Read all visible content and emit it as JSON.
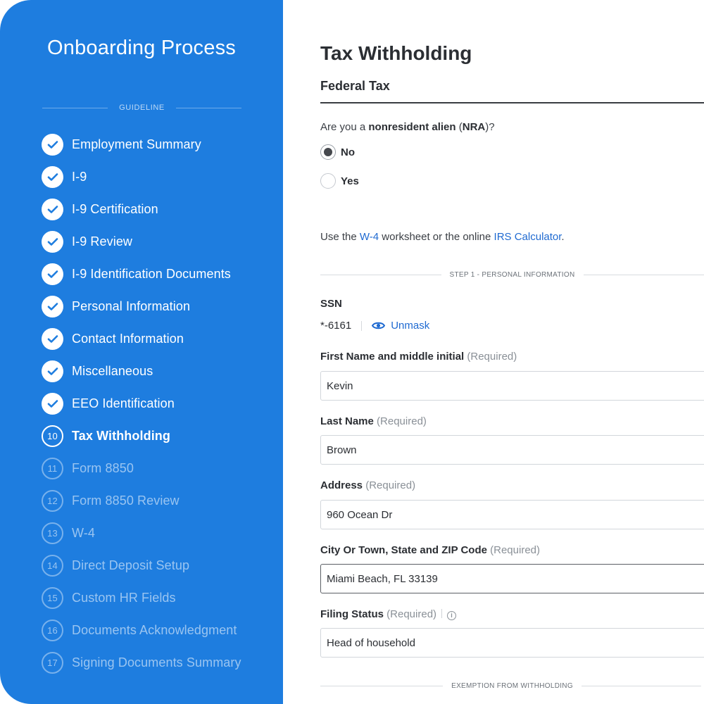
{
  "sidebar": {
    "title": "Onboarding Process",
    "guideline_label": "GUIDELINE",
    "steps": [
      {
        "number": "1",
        "label": "Employment Summary",
        "status": "done"
      },
      {
        "number": "2",
        "label": "I-9",
        "status": "done"
      },
      {
        "number": "3",
        "label": "I-9 Certification",
        "status": "done"
      },
      {
        "number": "4",
        "label": "I-9 Review",
        "status": "done"
      },
      {
        "number": "5",
        "label": "I-9 Identification Documents",
        "status": "done"
      },
      {
        "number": "6",
        "label": "Personal Information",
        "status": "done"
      },
      {
        "number": "7",
        "label": "Contact Information",
        "status": "done"
      },
      {
        "number": "8",
        "label": "Miscellaneous",
        "status": "done"
      },
      {
        "number": "9",
        "label": "EEO Identification",
        "status": "done"
      },
      {
        "number": "10",
        "label": "Tax Withholding",
        "status": "current"
      },
      {
        "number": "11",
        "label": "Form 8850",
        "status": "pending"
      },
      {
        "number": "12",
        "label": "Form 8850 Review",
        "status": "pending"
      },
      {
        "number": "13",
        "label": "W-4",
        "status": "pending"
      },
      {
        "number": "14",
        "label": "Direct Deposit Setup",
        "status": "pending"
      },
      {
        "number": "15",
        "label": "Custom HR Fields",
        "status": "pending"
      },
      {
        "number": "16",
        "label": "Documents Acknowledgment",
        "status": "pending"
      },
      {
        "number": "17",
        "label": "Signing Documents Summary",
        "status": "pending"
      }
    ]
  },
  "main": {
    "title": "Tax Withholding",
    "section_title": "Federal Tax",
    "nra_question": {
      "prefix": "Are you a ",
      "bold1": "nonresident alien",
      "mid": " (",
      "bold2": "NRA",
      "suffix": ")?"
    },
    "nra_options": [
      {
        "label": "No",
        "checked": true
      },
      {
        "label": "Yes",
        "checked": false
      }
    ],
    "help": {
      "prefix": "Use the ",
      "link1": "W-4",
      "mid": " worksheet or the online ",
      "link2": "IRS Calculator",
      "suffix": "."
    },
    "step1_divider": "STEP 1 - PERSONAL INFORMATION",
    "ssn": {
      "label": "SSN",
      "value": "*-6161",
      "unmask_label": "Unmask"
    },
    "required_text": "(Required)",
    "fields": {
      "first_name": {
        "label": "First Name and middle initial",
        "value": "Kevin"
      },
      "last_name": {
        "label": "Last Name",
        "value": "Brown"
      },
      "address": {
        "label": "Address",
        "value": "960 Ocean Dr"
      },
      "city": {
        "label": "City Or Town, State and ZIP Code",
        "value": "Miami Beach, FL 33139"
      },
      "filing_status": {
        "label": "Filing Status",
        "value": "Head of household"
      }
    },
    "exemption_divider": "EXEMPTION FROM WITHHOLDING"
  },
  "colors": {
    "sidebar_bg": "#1e7ddf",
    "link": "#1f6ad1",
    "check": "#1e7ddf"
  }
}
